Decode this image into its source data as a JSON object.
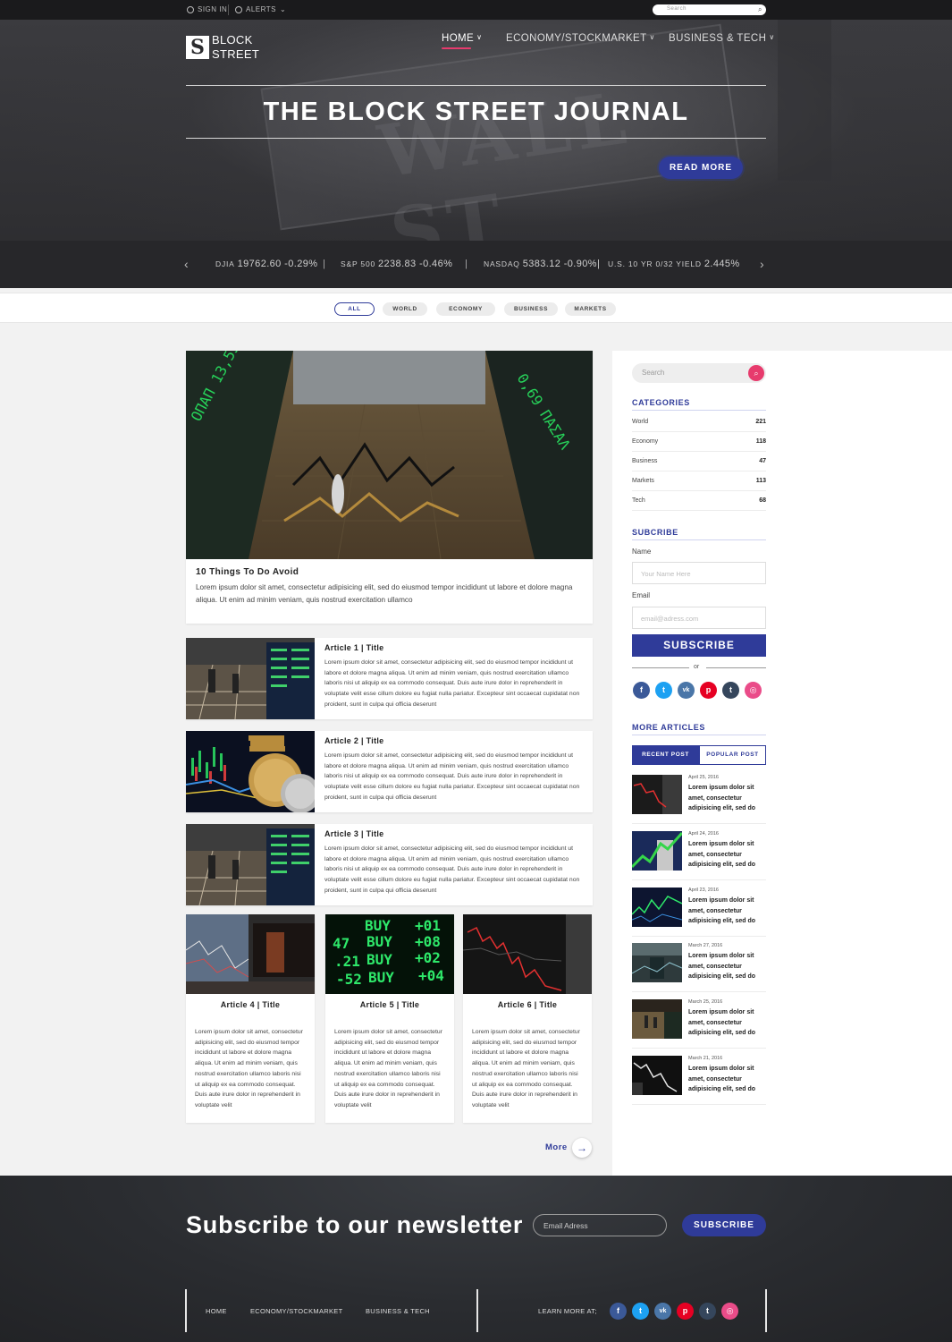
{
  "topbar": {
    "sign_in": "SIGN IN",
    "alerts": "ALERTS",
    "search_placeholder": "Search"
  },
  "brand": {
    "logo_letter": "S",
    "line1": "BLOCK",
    "line2": "STREET"
  },
  "nav": {
    "items": [
      "HOME",
      "ECONOMY/STOCKMARKET",
      "BUSINESS & TECH"
    ],
    "active": "HOME"
  },
  "hero": {
    "title": "THE BLOCK STREET JOURNAL",
    "cta": "READ MORE",
    "background_text": "WALL ST"
  },
  "ticker": {
    "quotes": [
      {
        "symbol": "DJIA",
        "value": "19762.60 -0.29%"
      },
      {
        "symbol": "S&P 500",
        "value": "2238.83 -0.46%"
      },
      {
        "symbol": "NASDAQ",
        "value": "5383.12 -0.90%|"
      },
      {
        "symbol": "U.S. 10 YR 0/32 YIELD",
        "value": "2.445%"
      }
    ],
    "separator": "|"
  },
  "filters": [
    "ALL",
    "WORLD",
    "ECONOMY",
    "BUSINESS",
    "MARKETS"
  ],
  "featured": {
    "title": "10 Things To Do Avoid",
    "body": "Lorem ipsum dolor sit amet, consectetur adipisicing elit, sed do eiusmod tempor incididunt ut labore et dolore magna aliqua. Ut enim ad minim veniam, quis nostrud exercitation ullamco"
  },
  "articles_list": [
    {
      "title": "Article 1 | Title",
      "body": "Lorem ipsum dolor sit amet, consectetur adipisicing elit, sed do eiusmod tempor incididunt ut labore et dolore magna aliqua. Ut enim ad minim veniam, quis nostrud exercitation ullamco laboris nisi ut aliquip ex ea commodo consequat. Duis aute irure dolor in reprehenderit in voluptate velit esse cillum dolore eu fugiat nulla pariatur. Excepteur sint occaecat cupidatat non proident, sunt in culpa qui officia deserunt"
    },
    {
      "title": "Article 2 | Title",
      "body": "Lorem ipsum dolor sit amet, consectetur adipisicing elit, sed do eiusmod tempor incididunt ut labore et dolore magna aliqua. Ut enim ad minim veniam, quis nostrud exercitation ullamco laboris nisi ut aliquip ex ea commodo consequat. Duis aute irure dolor in reprehenderit in voluptate velit esse cillum dolore eu fugiat nulla pariatur. Excepteur sint occaecat cupidatat non proident, sunt in culpa qui officia deserunt"
    },
    {
      "title": "Article 3 | Title",
      "body": "Lorem ipsum dolor sit amet, consectetur adipisicing elit, sed do eiusmod tempor incididunt ut labore et dolore magna aliqua. Ut enim ad minim veniam, quis nostrud exercitation ullamco laboris nisi ut aliquip ex ea commodo consequat. Duis aute irure dolor in reprehenderit in voluptate velit esse cillum dolore eu fugiat nulla pariatur. Excepteur sint occaecat cupidatat non proident, sunt in culpa qui officia deserunt"
    }
  ],
  "articles_grid": [
    {
      "title": "Article 4 | Title",
      "body": "Lorem ipsum dolor sit amet, consectetur adipisicing elit, sed do eiusmod tempor incididunt ut labore et dolore magna aliqua. Ut enim ad minim veniam, quis nostrud exercitation ullamco laboris nisi ut aliquip ex ea commodo consequat. Duis aute irure dolor in reprehenderit in voluptate velit"
    },
    {
      "title": "Article 5 | Title",
      "body": "Lorem ipsum dolor sit amet, consectetur adipisicing elit, sed do eiusmod tempor incididunt ut labore et dolore magna aliqua. Ut enim ad minim veniam, quis nostrud exercitation ullamco laboris nisi ut aliquip ex ea commodo consequat. Duis aute irure dolor in reprehenderit in voluptate velit"
    },
    {
      "title": "Article 6 | Title",
      "body": "Lorem ipsum dolor sit amet, consectetur adipisicing elit, sed do eiusmod tempor incididunt ut labore et dolore magna aliqua. Ut enim ad minim veniam, quis nostrud exercitation ullamco laboris nisi ut aliquip ex ea commodo consequat. Duis aute irure dolor in reprehenderit in voluptate velit"
    }
  ],
  "more_label": "More",
  "sidebar": {
    "search_placeholder": "Search",
    "categories_heading": "CATEGORIES",
    "categories": [
      {
        "name": "World",
        "count": "221"
      },
      {
        "name": "Economy",
        "count": "118"
      },
      {
        "name": "Business",
        "count": "47"
      },
      {
        "name": "Markets",
        "count": "113"
      },
      {
        "name": "Tech",
        "count": "68"
      }
    ],
    "subscribe_heading": "SUBCRIBE",
    "name_label": "Name",
    "name_placeholder": "Your Name Here",
    "email_label": "Email",
    "email_placeholder": "email@adress.com",
    "subscribe_button": "SUBSCRIBE",
    "or": "or",
    "more_heading": "MORE ARTICLES",
    "tabs": [
      "RECENT POST",
      "POPULAR POST"
    ],
    "posts": [
      {
        "date": "April 25, 2016",
        "text": "Lorem ipsum dolor sit amet, consectetur adipisicing elit, sed do"
      },
      {
        "date": "April 24, 2016",
        "text": "Lorem ipsum dolor sit amet, consectetur adipisicing elit, sed do"
      },
      {
        "date": "April 23, 2016",
        "text": "Lorem ipsum dolor sit amet, consectetur adipisicing elit, sed do"
      },
      {
        "date": "March 27, 2016",
        "text": "Lorem ipsum dolor sit amet, consectetur adipisicing elit, sed do"
      },
      {
        "date": "March 25, 2016",
        "text": "Lorem ipsum dolor sit amet, consectetur adipisicing elit, sed do"
      },
      {
        "date": "March 21, 2016",
        "text": "Lorem ipsum dolor sit amet, consectetur adipisicing elit, sed do"
      }
    ]
  },
  "social": [
    {
      "name": "facebook-icon",
      "glyph": "f",
      "color": "#3b5998"
    },
    {
      "name": "twitter-icon",
      "glyph": "t",
      "color": "#1da1f2"
    },
    {
      "name": "vk-icon",
      "glyph": "vk",
      "color": "#4a76a8"
    },
    {
      "name": "pinterest-icon",
      "glyph": "p",
      "color": "#e60023"
    },
    {
      "name": "tumblr-icon",
      "glyph": "t",
      "color": "#35465c"
    },
    {
      "name": "dribbble-icon",
      "glyph": "◎",
      "color": "#ea4c89"
    }
  ],
  "newsletter": {
    "heading": "Subscribe to our newsletter",
    "placeholder": "Email Adress",
    "button": "SUBSCRIBE"
  },
  "footer": {
    "links": [
      "HOME",
      "ECONOMY/STOCKMARKET",
      "BUSINESS & TECH"
    ],
    "learn_more": "LEARN MORE AT;"
  },
  "colors": {
    "accent": "#2f3b99",
    "highlight": "#e73b6d",
    "dark": "#2b2b2e"
  }
}
